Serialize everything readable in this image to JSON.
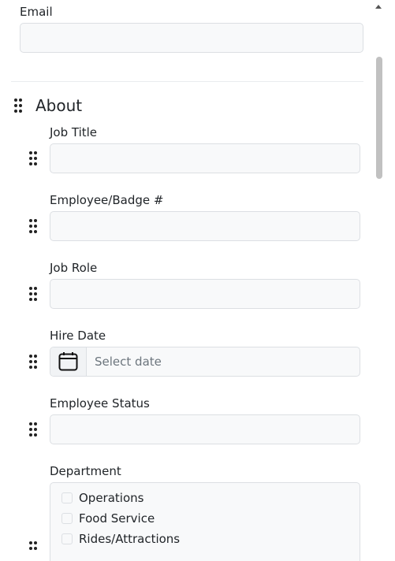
{
  "fields": {
    "email": {
      "label": "Email",
      "value": ""
    },
    "job_title": {
      "label": "Job Title",
      "value": ""
    },
    "badge": {
      "label": "Employee/Badge #",
      "value": ""
    },
    "job_role": {
      "label": "Job Role",
      "value": ""
    },
    "hire_date": {
      "label": "Hire Date",
      "placeholder": "Select date",
      "icon": "calendar-icon"
    },
    "status": {
      "label": "Employee Status",
      "value": ""
    },
    "department": {
      "label": "Department",
      "options": [
        "Operations",
        "Food Service",
        "Rides/Attractions"
      ]
    }
  },
  "sections": {
    "about": "About"
  },
  "icons": {
    "drag": "drag-handle-icon",
    "scroll_up": "scroll-up-arrow-icon"
  }
}
